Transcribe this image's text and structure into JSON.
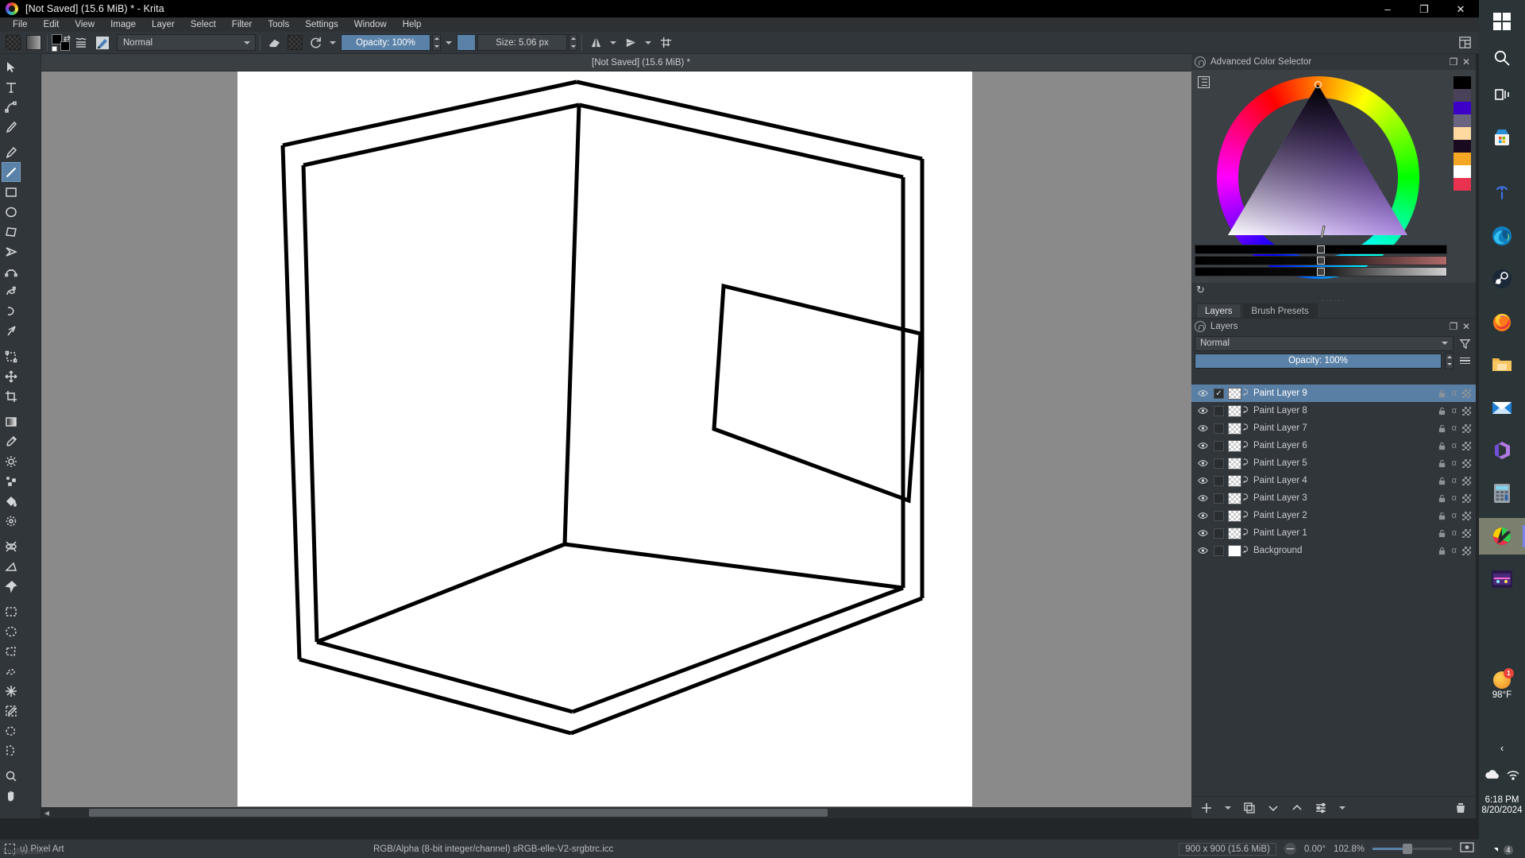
{
  "window": {
    "title": "[Not Saved]  (15.6 MiB) * - Krita",
    "app_icon": "krita-logo-icon",
    "minimize": "–",
    "maximize": "❐",
    "close": "✕"
  },
  "menubar": {
    "items": [
      {
        "label": "File",
        "mnemonic": "F"
      },
      {
        "label": "Edit",
        "mnemonic": "E"
      },
      {
        "label": "View",
        "mnemonic": "V"
      },
      {
        "label": "Image",
        "mnemonic": "I"
      },
      {
        "label": "Layer",
        "mnemonic": "L"
      },
      {
        "label": "Select",
        "mnemonic": "S"
      },
      {
        "label": "Filter",
        "mnemonic": "r"
      },
      {
        "label": "Tools",
        "mnemonic": "T"
      },
      {
        "label": "Settings",
        "mnemonic": "n"
      },
      {
        "label": "Window",
        "mnemonic": "W"
      },
      {
        "label": "Help",
        "mnemonic": "H"
      }
    ]
  },
  "toolbar": {
    "gradient_icon": "gradient-preset-icon",
    "pattern_icon": "pattern-preset-icon",
    "fg_bg_icon": "foreground-background-color-icon",
    "brush_editor_icon": "brush-editor-icon",
    "brush_preset_icon": "brush-preset-icon",
    "blend_mode": "Normal",
    "eraser_icon": "eraser-icon",
    "preserve_alpha_icon": "preserve-alpha-icon",
    "reload_preset_icon": "reload-preset-icon",
    "opacity_label": "Opacity: 100%",
    "size_label": "Size: 5.06 px",
    "mirror_h_icon": "mirror-horizontal-icon",
    "mirror_v_icon": "mirror-vertical-icon",
    "wraparound_icon": "wraparound-mode-icon",
    "workspace_icon": "workspace-switcher-icon"
  },
  "toolbox": {
    "tools": [
      {
        "name": "select-shapes-tool",
        "icon": "cursor-arrow-icon",
        "selected": false
      },
      {
        "name": "text-tool",
        "icon": "text-T-icon",
        "selected": false
      },
      {
        "name": "edit-shapes-tool",
        "icon": "node-edit-icon",
        "selected": false
      },
      {
        "name": "calligraphy-tool",
        "icon": "calligraphy-pen-icon",
        "selected": false
      },
      {
        "name": "freehand-brush-tool",
        "icon": "paintbrush-icon",
        "selected": false
      },
      {
        "name": "line-tool",
        "icon": "straight-line-icon",
        "selected": true
      },
      {
        "name": "rectangle-tool",
        "icon": "rectangle-icon",
        "selected": false
      },
      {
        "name": "ellipse-tool",
        "icon": "ellipse-icon",
        "selected": false
      },
      {
        "name": "polygon-tool",
        "icon": "polygon-icon",
        "selected": false
      },
      {
        "name": "polyline-tool",
        "icon": "polyline-icon",
        "selected": false
      },
      {
        "name": "bezier-curve-tool",
        "icon": "bezier-curve-icon",
        "selected": false
      },
      {
        "name": "freehand-path-tool",
        "icon": "freehand-path-icon",
        "selected": false
      },
      {
        "name": "dynamic-brush-tool",
        "icon": "dynamic-brush-icon",
        "selected": false
      },
      {
        "name": "multibrush-tool",
        "icon": "multibrush-icon",
        "selected": false
      },
      {
        "name": "transform-tool",
        "icon": "transform-icon",
        "selected": false
      },
      {
        "name": "move-tool",
        "icon": "move-cross-icon",
        "selected": false
      },
      {
        "name": "crop-tool",
        "icon": "crop-icon",
        "selected": false
      },
      {
        "name": "gradient-tool",
        "icon": "gradient-icon",
        "selected": false
      },
      {
        "name": "color-sampler-tool",
        "icon": "eyedropper-icon",
        "selected": false
      },
      {
        "name": "colorize-mask-tool",
        "icon": "colorize-mask-icon",
        "selected": false
      },
      {
        "name": "smart-patch-tool",
        "icon": "smart-patch-icon",
        "selected": false
      },
      {
        "name": "fill-tool",
        "icon": "paint-bucket-icon",
        "selected": false
      },
      {
        "name": "enclose-fill-tool",
        "icon": "enclose-fill-icon",
        "selected": false
      },
      {
        "name": "assistant-tool",
        "icon": "assistant-icon",
        "selected": false
      },
      {
        "name": "measure-tool",
        "icon": "measure-angle-icon",
        "selected": false
      },
      {
        "name": "reference-images-tool",
        "icon": "pin-icon",
        "selected": false
      },
      {
        "name": "rectangular-select-tool",
        "icon": "select-rectangle-icon",
        "selected": false
      },
      {
        "name": "elliptical-select-tool",
        "icon": "select-ellipse-icon",
        "selected": false
      },
      {
        "name": "polygonal-select-tool",
        "icon": "select-polygon-icon",
        "selected": false
      },
      {
        "name": "freehand-select-tool",
        "icon": "select-freehand-icon",
        "selected": false
      },
      {
        "name": "magic-wand-select-tool",
        "icon": "magic-wand-icon",
        "selected": false
      },
      {
        "name": "similar-color-select-tool",
        "icon": "select-similar-icon",
        "selected": false
      },
      {
        "name": "contiguous-select-tool",
        "icon": "select-contiguous-icon",
        "selected": false
      },
      {
        "name": "bezier-select-tool",
        "icon": "select-bezier-icon",
        "selected": false
      },
      {
        "name": "zoom-tool",
        "icon": "magnifier-icon",
        "selected": false
      },
      {
        "name": "pan-tool",
        "icon": "hand-icon",
        "selected": false
      }
    ]
  },
  "document": {
    "tab_label": "[Not Saved]  (15.6 MiB) *",
    "close_icon": "close-tab-icon"
  },
  "color_selector": {
    "title": "Advanced Color Selector",
    "settings_icon": "selector-settings-icon",
    "float_icon": "float-dock-icon",
    "close_icon": "close-dock-icon",
    "refresh_icon": "refresh-icon",
    "selected_hue_hex": "#5b16c8",
    "selected_color_hex": "#6a2ad4",
    "history_swatches": [
      "#000000",
      "#4a4258",
      "#3d00c8",
      "#6b6480",
      "#ffd9a0",
      "#1a0a20",
      "#f5a623",
      "#ffffff",
      "#e8324f"
    ]
  },
  "layers_panel": {
    "tabs": [
      {
        "label": "Layers",
        "active": true
      },
      {
        "label": "Brush Presets",
        "active": false
      }
    ],
    "title": "Layers",
    "float_icon": "float-dock-icon",
    "close_icon": "close-dock-icon",
    "blend_mode": "Normal",
    "filter_icon": "funnel-filter-icon",
    "opacity_label": "Opacity:  100%",
    "menu_icon": "layer-menu-icon",
    "layers": [
      {
        "name": "Paint Layer 9",
        "selected": true,
        "visible": true,
        "checked": true,
        "thumb": "transparent-dotted",
        "locked": false
      },
      {
        "name": "Paint Layer 8",
        "selected": false,
        "visible": true,
        "checked": false,
        "thumb": "transparent",
        "locked": false
      },
      {
        "name": "Paint Layer 7",
        "selected": false,
        "visible": true,
        "checked": false,
        "thumb": "transparent",
        "locked": false
      },
      {
        "name": "Paint Layer 6",
        "selected": false,
        "visible": true,
        "checked": false,
        "thumb": "transparent",
        "locked": false
      },
      {
        "name": "Paint Layer 5",
        "selected": false,
        "visible": true,
        "checked": false,
        "thumb": "transparent",
        "locked": false
      },
      {
        "name": "Paint Layer 4",
        "selected": false,
        "visible": true,
        "checked": false,
        "thumb": "transparent",
        "locked": false
      },
      {
        "name": "Paint Layer 3",
        "selected": false,
        "visible": true,
        "checked": false,
        "thumb": "transparent",
        "locked": false
      },
      {
        "name": "Paint Layer 2",
        "selected": false,
        "visible": true,
        "checked": false,
        "thumb": "transparent",
        "locked": false
      },
      {
        "name": "Paint Layer 1",
        "selected": false,
        "visible": true,
        "checked": false,
        "thumb": "transparent",
        "locked": false
      },
      {
        "name": "Background",
        "selected": false,
        "visible": true,
        "checked": false,
        "thumb": "white",
        "locked": true
      }
    ],
    "footer_buttons": [
      {
        "name": "add-layer-button",
        "icon": "plus-icon"
      },
      {
        "name": "duplicate-layer-button",
        "icon": "duplicate-icon"
      },
      {
        "name": "move-layer-down-button",
        "icon": "chevron-down-icon"
      },
      {
        "name": "move-layer-up-button",
        "icon": "chevron-up-icon"
      },
      {
        "name": "layer-properties-button",
        "icon": "sliders-icon"
      },
      {
        "name": "delete-layer-button",
        "icon": "trash-icon"
      }
    ]
  },
  "statusbar": {
    "selection_icon": "selection-mode-icon",
    "brush_preset": "u) Pixel Art",
    "color_profile": "RGB/Alpha (8-bit integer/channel)  sRGB-elle-V2-srgbtrc.icc",
    "dimensions": "900 x 900 (15.6 MiB)",
    "rotation": "0.00°",
    "zoom": "102.8%",
    "fit_icon": "fit-to-screen-icon",
    "watermark": "imgflip.com"
  },
  "taskbar": {
    "items": [
      {
        "name": "start-button",
        "icon": "windows-logo-icon"
      },
      {
        "name": "search-button",
        "icon": "search-icon"
      },
      {
        "name": "task-view-button",
        "icon": "task-view-icon"
      },
      {
        "name": "microsoft-store-button",
        "icon": "store-icon"
      },
      {
        "name": "info-button",
        "icon": "info-icon"
      },
      {
        "name": "edge-button",
        "icon": "edge-icon"
      },
      {
        "name": "steam-button",
        "icon": "steam-icon"
      },
      {
        "name": "firefox-button",
        "icon": "firefox-icon"
      },
      {
        "name": "file-explorer-button",
        "icon": "folder-icon"
      },
      {
        "name": "mail-button",
        "icon": "mail-icon"
      },
      {
        "name": "office-button",
        "icon": "office-icon"
      },
      {
        "name": "calculator-button",
        "icon": "calculator-icon"
      },
      {
        "name": "krita-taskbar-button",
        "icon": "krita-logo-icon"
      },
      {
        "name": "game-button",
        "icon": "game-thumbnail-icon"
      }
    ],
    "weather": {
      "temperature": "98°F",
      "badge": "1",
      "icon": "sun-icon"
    },
    "chevron_icon": "show-hidden-icons-icon",
    "cloud_icon": "onedrive-cloud-icon",
    "wifi_icon": "wifi-icon",
    "time": "6:18 PM",
    "date": "8/20/2024",
    "notification_count": "4"
  },
  "canvas_art": {
    "description": "Black line drawing of an open cube / room interior in perspective with a rectangular picture frame on the right wall",
    "stroke_color": "#000000",
    "background_color": "#ffffff"
  }
}
